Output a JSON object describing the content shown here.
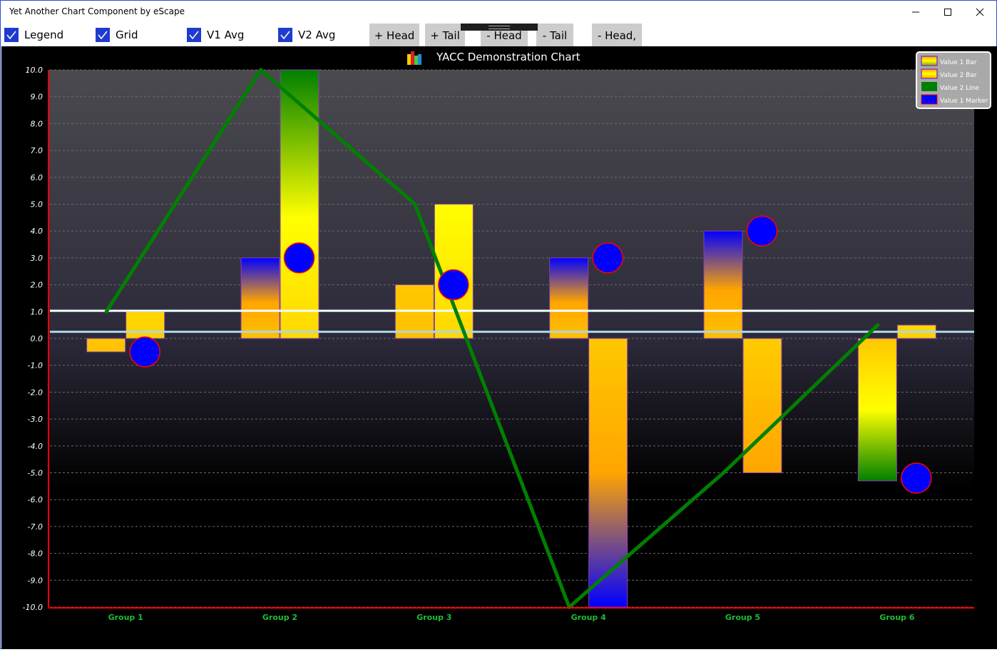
{
  "window": {
    "title": "Yet Another Chart Component by eScape",
    "controls": {
      "minimize": "—",
      "maximize": "☐",
      "close": "✕"
    }
  },
  "toolbar": {
    "checkboxes": [
      {
        "label": "Legend",
        "checked": true
      },
      {
        "label": "Grid",
        "checked": true
      },
      {
        "label": "V1 Avg",
        "checked": true
      },
      {
        "label": "V2 Avg",
        "checked": true
      }
    ],
    "buttons": [
      {
        "label": "+ Head"
      },
      {
        "label": "+ Tail"
      },
      {
        "label": "- Head"
      },
      {
        "label": "- Tail"
      },
      {
        "label": "- Head,"
      }
    ]
  },
  "colors": {
    "checkbox": "#1f3bcf",
    "axis": "#ff0000",
    "category_label": "#22bb33",
    "v2_line": "#008000",
    "marker_fill": "#0000ff",
    "marker_stroke": "#ff0000",
    "v1_avg": "#f0ffff",
    "v2_avg": "#add8e6",
    "bar_stroke": "#8a3fb0"
  },
  "chart_data": {
    "type": "bar",
    "title": "YACC Demonstration Chart",
    "xlabel": "",
    "ylabel": "",
    "ylim": [
      -10,
      10
    ],
    "yticks": [
      "10.0",
      "9.0",
      "8.0",
      "7.0",
      "6.0",
      "5.0",
      "4.0",
      "3.0",
      "2.0",
      "1.0",
      "0.0",
      "-1.0",
      "-2.0",
      "-3.0",
      "-4.0",
      "-5.0",
      "-6.0",
      "-7.0",
      "-8.0",
      "-9.0",
      "-10.0"
    ],
    "grid": true,
    "legend_position": "top-right",
    "categories": [
      "Group 1",
      "Group 2",
      "Group 3",
      "Group 4",
      "Group 5",
      "Group 6"
    ],
    "series": [
      {
        "name": "Value 1 Bar",
        "kind": "bar",
        "values": [
          -0.5,
          3,
          2,
          3,
          4,
          -5.3
        ]
      },
      {
        "name": "Value 2 Bar",
        "kind": "bar",
        "values": [
          1,
          10,
          5,
          -10,
          -5,
          0.5
        ]
      },
      {
        "name": "Value 2 Line",
        "kind": "line",
        "values": [
          1,
          10,
          5,
          -10,
          -5,
          0.5
        ]
      },
      {
        "name": "Value 1 Marker",
        "kind": "marker",
        "values": [
          -0.5,
          3,
          2,
          3,
          4,
          -5.2
        ]
      }
    ],
    "averages": {
      "V1 Avg": 1.03,
      "V2 Avg": 0.25
    }
  }
}
